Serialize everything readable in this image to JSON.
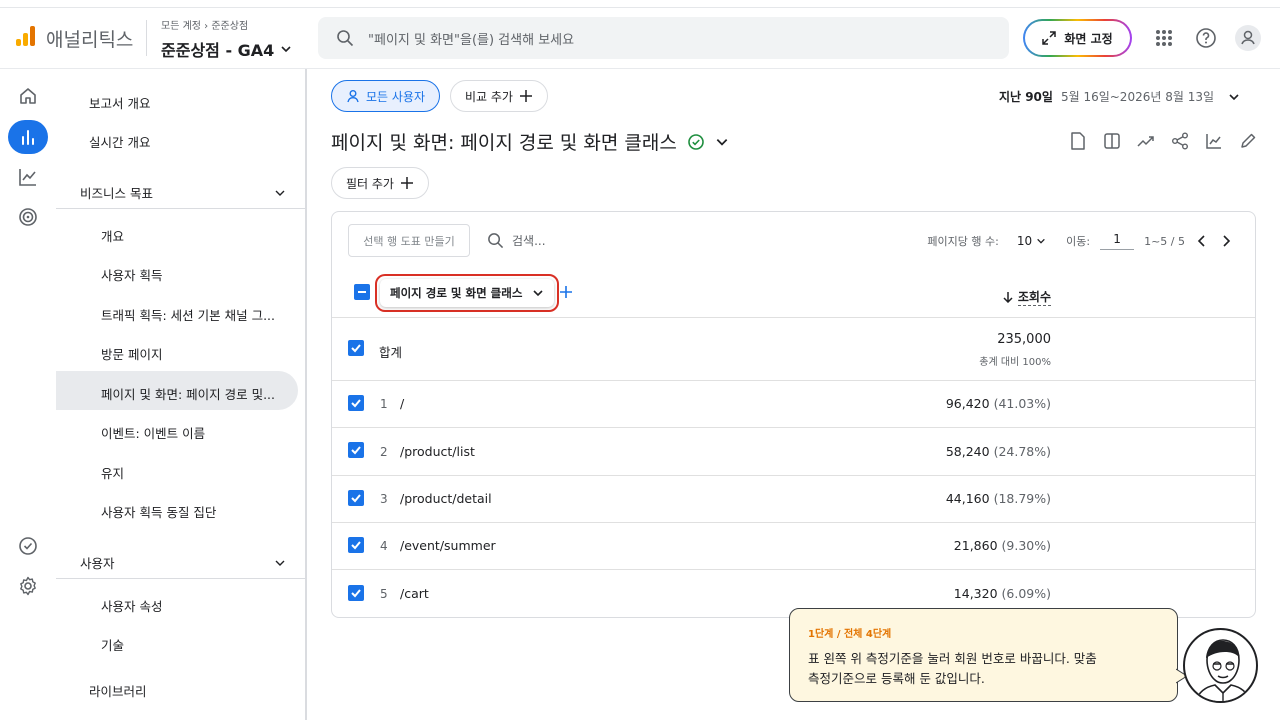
{
  "header": {
    "brand": "애널리틱스",
    "crumb_account": "모든 계정",
    "crumb_sep": "›",
    "crumb_store": "준준상점",
    "property": "준준상점 - GA4",
    "search_placeholder": "\"페이지 및 화면\"을(를) 검색해 보세요",
    "pin_label": "화면 고정"
  },
  "nav": {
    "report_overview": "보고서 개요",
    "realtime": "실시간 개요",
    "section_business": "비즈니스 목표",
    "business_items": [
      "개요",
      "사용자 획득",
      "트래픽 획득: 세션 기본 채널 그...",
      "방문 페이지",
      "페이지 및 화면: 페이지 경로 및...",
      "이벤트: 이벤트 이름",
      "유지",
      "사용자 획득 동질 집단"
    ],
    "section_user": "사용자",
    "user_items": [
      "사용자 속성",
      "기술"
    ],
    "library": "라이브러리"
  },
  "toolbar": {
    "all_users": "모든 사용자",
    "add_compare": "비교 추가",
    "date_label": "지난 90일",
    "date_range": "5월 16일~2026년 8월 13일"
  },
  "page": {
    "title": "페이지 및 화면: 페이지 경로 및 화면 클래스",
    "add_filter": "필터 추가"
  },
  "table": {
    "plot_button": "선택 행 도표 만들기",
    "search_placeholder": "검색...",
    "rows_per_page_label": "페이지당 행 수:",
    "rows_per_page": "10",
    "goto_label": "이동:",
    "goto_value": "1",
    "range": "1~5 / 5",
    "dimension": "페이지 경로 및 화면 클래스",
    "metric": "조회수",
    "total_label": "합계",
    "total_value": "235,000",
    "total_sub": "총계 대비 100%",
    "rows": [
      {
        "n": "1",
        "path": "/",
        "value": "96,420",
        "pct": "(41.03%)"
      },
      {
        "n": "2",
        "path": "/product/list",
        "value": "58,240",
        "pct": "(24.78%)"
      },
      {
        "n": "3",
        "path": "/product/detail",
        "value": "44,160",
        "pct": "(18.79%)"
      },
      {
        "n": "4",
        "path": "/event/summer",
        "value": "21,860",
        "pct": "(9.30%)"
      },
      {
        "n": "5",
        "path": "/cart",
        "value": "14,320",
        "pct": "(6.09%)"
      }
    ]
  },
  "tip": {
    "step": "1단계 / 전체 4단계",
    "line1": "표 왼쪽 위 측정기준을 눌러 회원 번호로 바꿉니다. 맞춤",
    "line2": "측정기준으로 등록해 둔 값입니다."
  },
  "colors": {
    "accent": "#1a73e8",
    "highlight": "#d93025",
    "tip_bg": "#fef7e0",
    "tip_step": "#e37400"
  }
}
